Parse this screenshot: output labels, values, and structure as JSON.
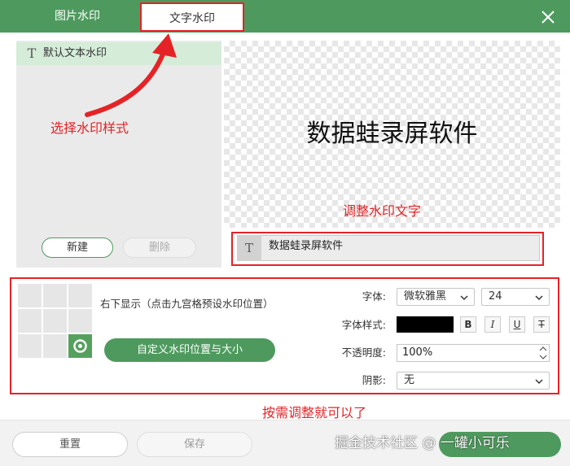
{
  "tabs": [
    {
      "label": "图片水印"
    },
    {
      "label": "文字水印"
    }
  ],
  "templates": {
    "items": [
      {
        "label": "默认文本水印",
        "icon": "text-t-icon"
      }
    ],
    "new_label": "新建",
    "delete_label": "删除"
  },
  "preview": {
    "text": "数据蛙录屏软件"
  },
  "text_input": {
    "value": "数据蛙录屏软件",
    "icon": "text-t-icon"
  },
  "position": {
    "description": "右下显示（点击九宫格预设水印位置）",
    "custom_button_label": "自定义水印位置与大小",
    "selected_cell": 9
  },
  "font": {
    "label": "字体:",
    "family_value": "微软雅黑",
    "size_value": "24",
    "style_label": "字体样式:",
    "color": "#000000",
    "style_buttons": [
      "B",
      "I",
      "U",
      "T"
    ]
  },
  "opacity": {
    "label": "不透明度:",
    "value": "100%"
  },
  "shadow": {
    "label": "阴影:",
    "value": "无"
  },
  "annotations": {
    "select_style": "选择水印样式",
    "adjust_text": "调整水印文字",
    "adjust_settings": "按需调整就可以了"
  },
  "footer": {
    "reset_label": "重置",
    "save_label": "保存"
  },
  "watermark_credit": "掘金技术社区 @ 一罐小可乐",
  "colors": {
    "brand_green": "#4e9a5e",
    "annotation_red": "#e52326"
  }
}
